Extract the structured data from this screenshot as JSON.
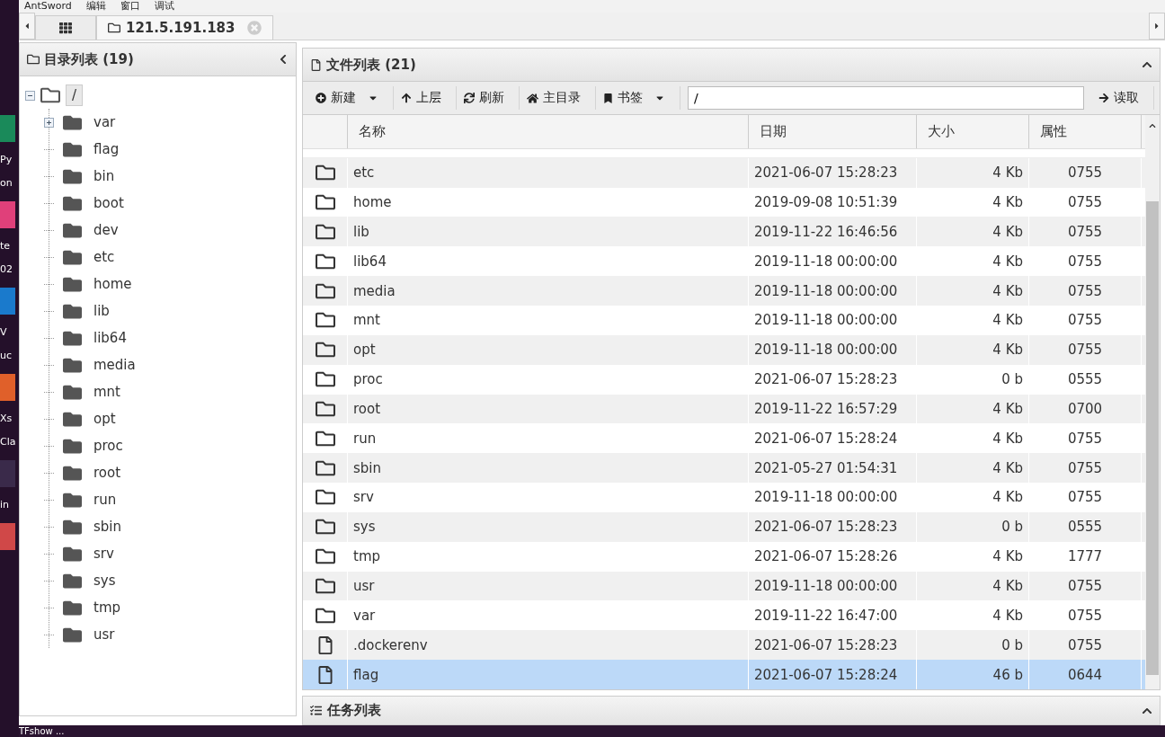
{
  "desktop": {
    "labels": [
      "Py",
      "on",
      "te",
      "02",
      "V",
      "uc",
      "Xs",
      "Cla",
      "in"
    ],
    "taskbar_label": "TFshow ..."
  },
  "menu": [
    "AntSword",
    "编辑",
    "窗口",
    "调试"
  ],
  "tabs": [
    {
      "kind": "home",
      "selected": false
    },
    {
      "kind": "host",
      "label": "121.5.191.183",
      "selected": true
    }
  ],
  "dir_panel": {
    "title": "目录列表 (19)",
    "tree": {
      "name": "/",
      "expanded": true,
      "selected": true,
      "children": [
        {
          "name": "var",
          "expanded": false
        },
        {
          "name": "flag"
        },
        {
          "name": "bin"
        },
        {
          "name": "boot"
        },
        {
          "name": "dev"
        },
        {
          "name": "etc"
        },
        {
          "name": "home"
        },
        {
          "name": "lib"
        },
        {
          "name": "lib64"
        },
        {
          "name": "media"
        },
        {
          "name": "mnt"
        },
        {
          "name": "opt"
        },
        {
          "name": "proc"
        },
        {
          "name": "root"
        },
        {
          "name": "run"
        },
        {
          "name": "sbin"
        },
        {
          "name": "srv"
        },
        {
          "name": "sys"
        },
        {
          "name": "tmp"
        },
        {
          "name": "usr"
        }
      ]
    }
  },
  "file_panel": {
    "title": "文件列表 (21)",
    "toolbar": [
      {
        "kind": "new",
        "label": "新建",
        "dropdown": true
      },
      {
        "kind": "up",
        "label": "上层"
      },
      {
        "kind": "refresh",
        "label": "刷新"
      },
      {
        "kind": "home",
        "label": "主目录"
      },
      {
        "kind": "bookmark",
        "label": "书签",
        "dropdown": true
      }
    ],
    "path": "/",
    "read_button": "读取",
    "columns": [
      "名称",
      "日期",
      "大小",
      "属性"
    ],
    "rows": [
      {
        "kind": "folder",
        "name": "etc",
        "date": "2021-06-07 15:28:23",
        "size": "4 Kb",
        "mode": "0755",
        "selected": false
      },
      {
        "kind": "folder",
        "name": "home",
        "date": "2019-09-08 10:51:39",
        "size": "4 Kb",
        "mode": "0755",
        "selected": false
      },
      {
        "kind": "folder",
        "name": "lib",
        "date": "2019-11-22 16:46:56",
        "size": "4 Kb",
        "mode": "0755",
        "selected": false
      },
      {
        "kind": "folder",
        "name": "lib64",
        "date": "2019-11-18 00:00:00",
        "size": "4 Kb",
        "mode": "0755",
        "selected": false
      },
      {
        "kind": "folder",
        "name": "media",
        "date": "2019-11-18 00:00:00",
        "size": "4 Kb",
        "mode": "0755",
        "selected": false
      },
      {
        "kind": "folder",
        "name": "mnt",
        "date": "2019-11-18 00:00:00",
        "size": "4 Kb",
        "mode": "0755",
        "selected": false
      },
      {
        "kind": "folder",
        "name": "opt",
        "date": "2019-11-18 00:00:00",
        "size": "4 Kb",
        "mode": "0755",
        "selected": false
      },
      {
        "kind": "folder",
        "name": "proc",
        "date": "2021-06-07 15:28:23",
        "size": "0 b",
        "mode": "0555",
        "selected": false
      },
      {
        "kind": "folder",
        "name": "root",
        "date": "2019-11-22 16:57:29",
        "size": "4 Kb",
        "mode": "0700",
        "selected": false
      },
      {
        "kind": "folder",
        "name": "run",
        "date": "2021-06-07 15:28:24",
        "size": "4 Kb",
        "mode": "0755",
        "selected": false
      },
      {
        "kind": "folder",
        "name": "sbin",
        "date": "2021-05-27 01:54:31",
        "size": "4 Kb",
        "mode": "0755",
        "selected": false
      },
      {
        "kind": "folder",
        "name": "srv",
        "date": "2019-11-18 00:00:00",
        "size": "4 Kb",
        "mode": "0755",
        "selected": false
      },
      {
        "kind": "folder",
        "name": "sys",
        "date": "2021-06-07 15:28:23",
        "size": "0 b",
        "mode": "0555",
        "selected": false
      },
      {
        "kind": "folder",
        "name": "tmp",
        "date": "2021-06-07 15:28:26",
        "size": "4 Kb",
        "mode": "1777",
        "selected": false
      },
      {
        "kind": "folder",
        "name": "usr",
        "date": "2019-11-18 00:00:00",
        "size": "4 Kb",
        "mode": "0755",
        "selected": false
      },
      {
        "kind": "folder",
        "name": "var",
        "date": "2019-11-22 16:47:00",
        "size": "4 Kb",
        "mode": "0755",
        "selected": false
      },
      {
        "kind": "file",
        "name": ".dockerenv",
        "date": "2021-06-07 15:28:23",
        "size": "0 b",
        "mode": "0755",
        "selected": false
      },
      {
        "kind": "file",
        "name": "flag",
        "date": "2021-06-07 15:28:24",
        "size": "46 b",
        "mode": "0644",
        "selected": true
      }
    ]
  },
  "task_panel": {
    "title": "任务列表"
  }
}
